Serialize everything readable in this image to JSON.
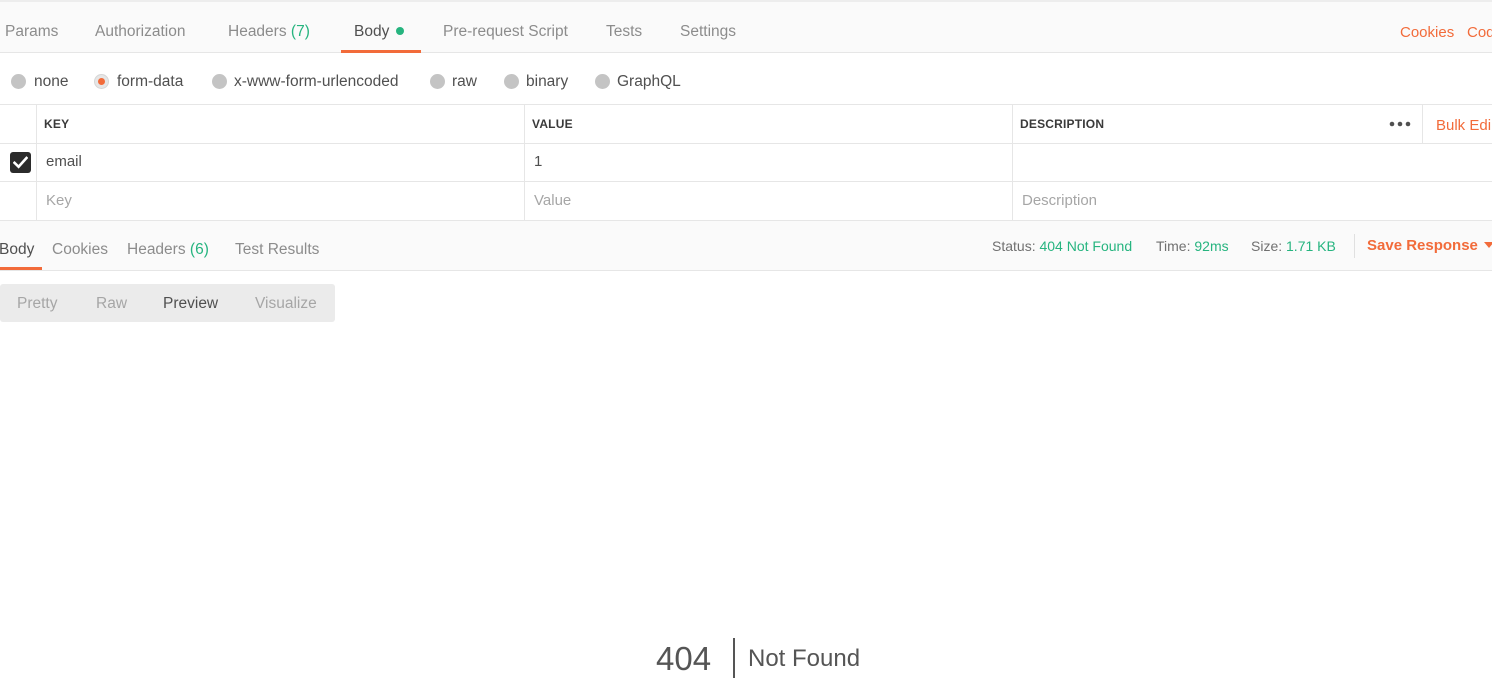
{
  "request_tabs": [
    {
      "label": "Params"
    },
    {
      "label": "Authorization"
    },
    {
      "label": "Headers",
      "count": "(7)"
    },
    {
      "label": "Body",
      "active": true
    },
    {
      "label": "Pre-request Script"
    },
    {
      "label": "Tests"
    },
    {
      "label": "Settings"
    }
  ],
  "right_links": {
    "cookies": "Cookies",
    "code": "Cod"
  },
  "body_types": [
    {
      "label": "none"
    },
    {
      "label": "form-data",
      "selected": true
    },
    {
      "label": "x-www-form-urlencoded"
    },
    {
      "label": "raw"
    },
    {
      "label": "binary"
    },
    {
      "label": "GraphQL"
    }
  ],
  "params_table": {
    "headers": {
      "key": "KEY",
      "value": "VALUE",
      "description": "DESCRIPTION"
    },
    "bulk_edit": "Bulk Edi",
    "rows": [
      {
        "checked": true,
        "key": "email",
        "value": "1",
        "description": ""
      }
    ],
    "placeholders": {
      "key": "Key",
      "value": "Value",
      "description": "Description"
    }
  },
  "response": {
    "tabs": [
      {
        "label": "Body",
        "active": true
      },
      {
        "label": "Cookies"
      },
      {
        "label": "Headers",
        "count": "(6)"
      },
      {
        "label": "Test Results"
      }
    ],
    "status_label": "Status:",
    "status_value": "404 Not Found",
    "time_label": "Time:",
    "time_value": "92ms",
    "size_label": "Size:",
    "size_value": "1.71 KB",
    "save_label": "Save Response"
  },
  "view_modes": [
    {
      "label": "Pretty"
    },
    {
      "label": "Raw"
    },
    {
      "label": "Preview",
      "active": true
    },
    {
      "label": "Visualize"
    }
  ],
  "preview": {
    "code": "404",
    "message": "Not Found"
  },
  "colors": {
    "accent": "#f26b3a",
    "success": "#26b47f"
  }
}
